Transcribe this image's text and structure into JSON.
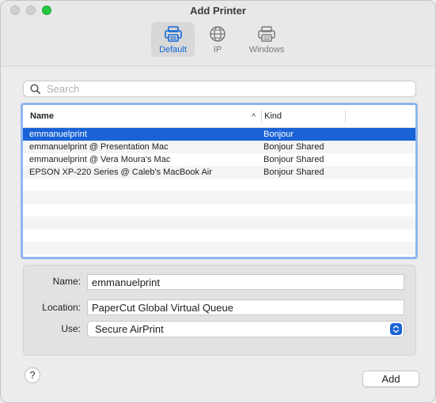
{
  "window": {
    "title": "Add Printer"
  },
  "tabs": [
    {
      "label": "Default",
      "icon": "printer-icon",
      "active": true
    },
    {
      "label": "IP",
      "icon": "globe-icon",
      "active": false
    },
    {
      "label": "Windows",
      "icon": "windows-printer-icon",
      "active": false
    }
  ],
  "search": {
    "placeholder": "Search",
    "value": ""
  },
  "table": {
    "columns": [
      "Name",
      "Kind"
    ],
    "rows": [
      {
        "name": "emmanuelprint",
        "kind": "Bonjour",
        "selected": true
      },
      {
        "name": "emmanuelprint @ Presentation Mac",
        "kind": "Bonjour Shared",
        "selected": false
      },
      {
        "name": "emmanuelprint @ Vera Moura's Mac",
        "kind": "Bonjour Shared",
        "selected": false
      },
      {
        "name": "EPSON XP-220 Series @ Caleb's MacBook Air",
        "kind": "Bonjour Shared",
        "selected": false
      }
    ]
  },
  "form": {
    "name_label": "Name:",
    "name_value": "emmanuelprint",
    "location_label": "Location:",
    "location_value": "PaperCut Global Virtual Queue",
    "use_label": "Use:",
    "use_value": "Secure AirPrint"
  },
  "footer": {
    "help_label": "?",
    "add_label": "Add"
  },
  "colors": {
    "accent": "#1a63d6",
    "focus_ring": "#8fb6ee"
  }
}
